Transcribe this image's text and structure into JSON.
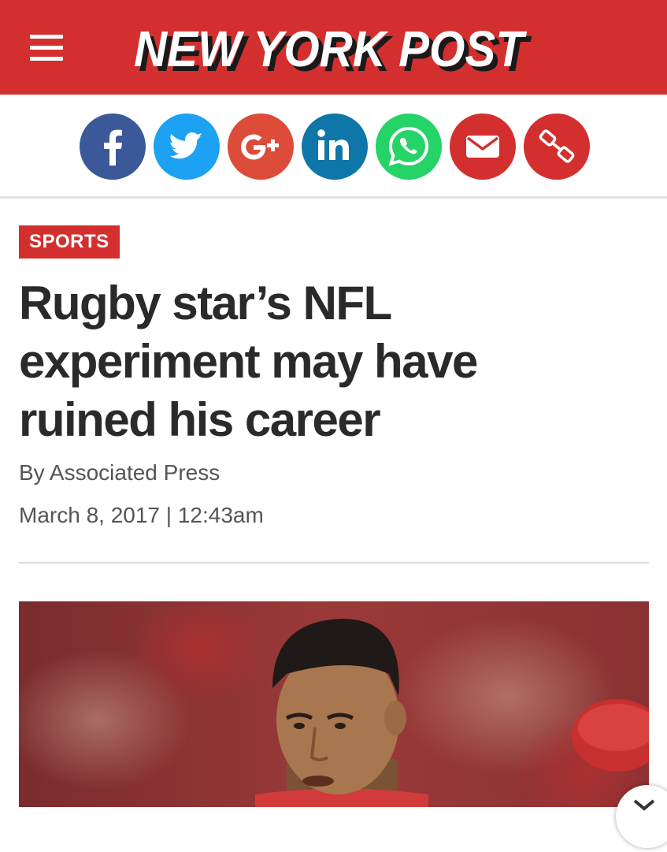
{
  "header": {
    "logo_text": "NEW YORK POST",
    "brand_color": "#d32f2f",
    "menu_icon": "hamburger-menu-icon"
  },
  "share": {
    "buttons": [
      {
        "network": "facebook",
        "icon": "facebook-icon",
        "color": "#3b5998"
      },
      {
        "network": "twitter",
        "icon": "twitter-icon",
        "color": "#1da1f2"
      },
      {
        "network": "google-plus",
        "icon": "google-plus-icon",
        "color": "#dd4b39"
      },
      {
        "network": "linkedin",
        "icon": "linkedin-icon",
        "color": "#0e76a8"
      },
      {
        "network": "whatsapp",
        "icon": "whatsapp-icon",
        "color": "#25d366"
      },
      {
        "network": "email",
        "icon": "email-icon",
        "color": "#d32f2f"
      },
      {
        "network": "copy-link",
        "icon": "link-icon",
        "color": "#d32f2f"
      }
    ]
  },
  "article": {
    "section": "SPORTS",
    "headline_lines": [
      "Rugby star’s NFL",
      "experiment may have",
      "ruined his career"
    ],
    "byline": "By Associated Press",
    "dateline": "March 8, 2017 | 12:43am"
  },
  "hero_image": {
    "alt_subject": "photo of player",
    "tone": "#8a2a2a"
  },
  "overlay": {
    "close_icon": "close-icon"
  }
}
